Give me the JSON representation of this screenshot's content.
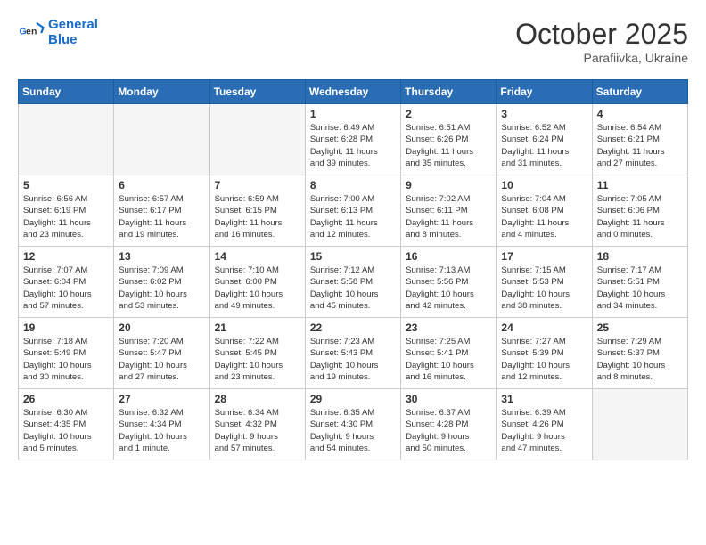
{
  "header": {
    "logo_line1": "General",
    "logo_line2": "Blue",
    "month": "October 2025",
    "location": "Parafiivka, Ukraine"
  },
  "weekdays": [
    "Sunday",
    "Monday",
    "Tuesday",
    "Wednesday",
    "Thursday",
    "Friday",
    "Saturday"
  ],
  "weeks": [
    [
      {
        "day": "",
        "empty": true
      },
      {
        "day": "",
        "empty": true
      },
      {
        "day": "",
        "empty": true
      },
      {
        "day": "1",
        "info": "Sunrise: 6:49 AM\nSunset: 6:28 PM\nDaylight: 11 hours\nand 39 minutes."
      },
      {
        "day": "2",
        "info": "Sunrise: 6:51 AM\nSunset: 6:26 PM\nDaylight: 11 hours\nand 35 minutes."
      },
      {
        "day": "3",
        "info": "Sunrise: 6:52 AM\nSunset: 6:24 PM\nDaylight: 11 hours\nand 31 minutes."
      },
      {
        "day": "4",
        "info": "Sunrise: 6:54 AM\nSunset: 6:21 PM\nDaylight: 11 hours\nand 27 minutes."
      }
    ],
    [
      {
        "day": "5",
        "info": "Sunrise: 6:56 AM\nSunset: 6:19 PM\nDaylight: 11 hours\nand 23 minutes."
      },
      {
        "day": "6",
        "info": "Sunrise: 6:57 AM\nSunset: 6:17 PM\nDaylight: 11 hours\nand 19 minutes."
      },
      {
        "day": "7",
        "info": "Sunrise: 6:59 AM\nSunset: 6:15 PM\nDaylight: 11 hours\nand 16 minutes."
      },
      {
        "day": "8",
        "info": "Sunrise: 7:00 AM\nSunset: 6:13 PM\nDaylight: 11 hours\nand 12 minutes."
      },
      {
        "day": "9",
        "info": "Sunrise: 7:02 AM\nSunset: 6:11 PM\nDaylight: 11 hours\nand 8 minutes."
      },
      {
        "day": "10",
        "info": "Sunrise: 7:04 AM\nSunset: 6:08 PM\nDaylight: 11 hours\nand 4 minutes."
      },
      {
        "day": "11",
        "info": "Sunrise: 7:05 AM\nSunset: 6:06 PM\nDaylight: 11 hours\nand 0 minutes."
      }
    ],
    [
      {
        "day": "12",
        "info": "Sunrise: 7:07 AM\nSunset: 6:04 PM\nDaylight: 10 hours\nand 57 minutes."
      },
      {
        "day": "13",
        "info": "Sunrise: 7:09 AM\nSunset: 6:02 PM\nDaylight: 10 hours\nand 53 minutes."
      },
      {
        "day": "14",
        "info": "Sunrise: 7:10 AM\nSunset: 6:00 PM\nDaylight: 10 hours\nand 49 minutes."
      },
      {
        "day": "15",
        "info": "Sunrise: 7:12 AM\nSunset: 5:58 PM\nDaylight: 10 hours\nand 45 minutes."
      },
      {
        "day": "16",
        "info": "Sunrise: 7:13 AM\nSunset: 5:56 PM\nDaylight: 10 hours\nand 42 minutes."
      },
      {
        "day": "17",
        "info": "Sunrise: 7:15 AM\nSunset: 5:53 PM\nDaylight: 10 hours\nand 38 minutes."
      },
      {
        "day": "18",
        "info": "Sunrise: 7:17 AM\nSunset: 5:51 PM\nDaylight: 10 hours\nand 34 minutes."
      }
    ],
    [
      {
        "day": "19",
        "info": "Sunrise: 7:18 AM\nSunset: 5:49 PM\nDaylight: 10 hours\nand 30 minutes."
      },
      {
        "day": "20",
        "info": "Sunrise: 7:20 AM\nSunset: 5:47 PM\nDaylight: 10 hours\nand 27 minutes."
      },
      {
        "day": "21",
        "info": "Sunrise: 7:22 AM\nSunset: 5:45 PM\nDaylight: 10 hours\nand 23 minutes."
      },
      {
        "day": "22",
        "info": "Sunrise: 7:23 AM\nSunset: 5:43 PM\nDaylight: 10 hours\nand 19 minutes."
      },
      {
        "day": "23",
        "info": "Sunrise: 7:25 AM\nSunset: 5:41 PM\nDaylight: 10 hours\nand 16 minutes."
      },
      {
        "day": "24",
        "info": "Sunrise: 7:27 AM\nSunset: 5:39 PM\nDaylight: 10 hours\nand 12 minutes."
      },
      {
        "day": "25",
        "info": "Sunrise: 7:29 AM\nSunset: 5:37 PM\nDaylight: 10 hours\nand 8 minutes."
      }
    ],
    [
      {
        "day": "26",
        "info": "Sunrise: 6:30 AM\nSunset: 4:35 PM\nDaylight: 10 hours\nand 5 minutes."
      },
      {
        "day": "27",
        "info": "Sunrise: 6:32 AM\nSunset: 4:34 PM\nDaylight: 10 hours\nand 1 minute."
      },
      {
        "day": "28",
        "info": "Sunrise: 6:34 AM\nSunset: 4:32 PM\nDaylight: 9 hours\nand 57 minutes."
      },
      {
        "day": "29",
        "info": "Sunrise: 6:35 AM\nSunset: 4:30 PM\nDaylight: 9 hours\nand 54 minutes."
      },
      {
        "day": "30",
        "info": "Sunrise: 6:37 AM\nSunset: 4:28 PM\nDaylight: 9 hours\nand 50 minutes."
      },
      {
        "day": "31",
        "info": "Sunrise: 6:39 AM\nSunset: 4:26 PM\nDaylight: 9 hours\nand 47 minutes."
      },
      {
        "day": "",
        "empty": true
      }
    ]
  ]
}
